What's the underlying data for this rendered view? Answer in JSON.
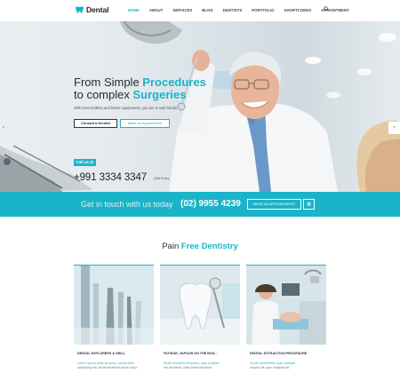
{
  "brand": {
    "name": "Dental",
    "accent": "#1bb3c8"
  },
  "nav": {
    "items": [
      "HOME",
      "ABOUT",
      "SERVICES",
      "BLOG",
      "DENTISTS",
      "PORTFOLIO",
      "SHORTCODES",
      "APPOINTMENT"
    ],
    "active": "HOME",
    "search_icon": "search-icon"
  },
  "hero": {
    "title_line1_plain": "From Simple ",
    "title_line1_highlight": "Procedures",
    "title_line2_plain": "to complex ",
    "title_line2_highlight": "Surgeries",
    "subtitle": "With best facilities and better equipments, you are in safe hands",
    "btn_consult": "Consult a Dentist",
    "btn_appointment": "Make an Appointment",
    "call_label": "Call us @",
    "phone": "+991 3334 3347",
    "phone_note": "(Toll Free)",
    "prev_icon": "chevron-left-icon",
    "next_icon": "chevron-right-icon"
  },
  "cta": {
    "text": "Get in touch with us today",
    "phone": "(02) 9955 4239",
    "button": "MAKE AN APPOINTMENT",
    "button_icon": "calendar-icon"
  },
  "services": {
    "title_plain": "Pain ",
    "title_highlight": "Free Dentistry",
    "cards": [
      {
        "title": "DENTAL EXPLORERS & DRILL",
        "text_line1": "Lorem ipsum dolor sit amet, consectetur",
        "text_line2": "adipiscing elit. Morbi hendrerit ipsum dolor"
      },
      {
        "title": "FATIGUE, VAPOUR ON THE BOD...",
        "text_line1": "Morbi hendrerit elit ipsum, quis volutpat",
        "text_line2": "est hendrerit, vitae lorem tincidunt"
      },
      {
        "title": "DENTAL EXTRACTION PROCEDURE",
        "text_line1": "Ut elit consectetur, quis volutpat",
        "text_line2": "mauris elit, quis volutpat est"
      }
    ]
  }
}
